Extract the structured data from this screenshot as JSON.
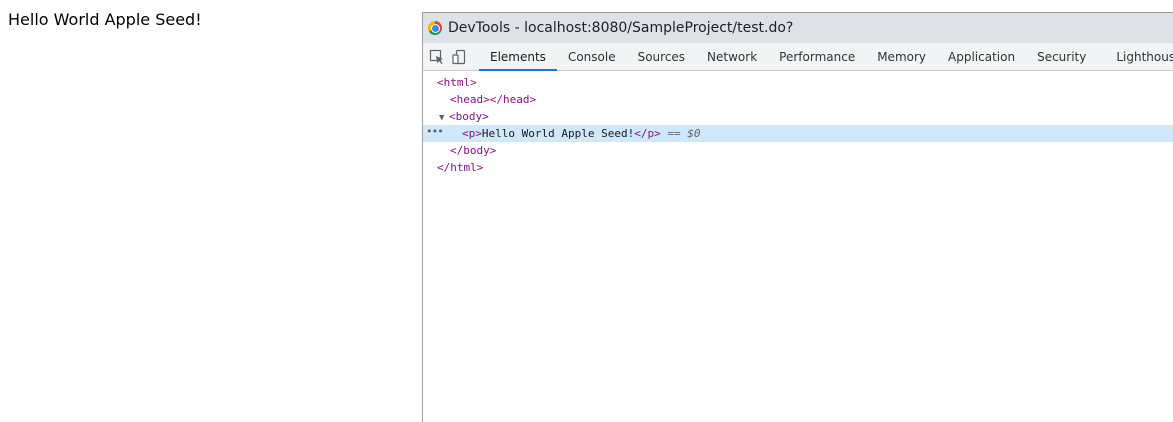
{
  "page": {
    "paragraph_text": "Hello World Apple Seed!"
  },
  "devtools": {
    "window_title": "DevTools - localhost:8080/SampleProject/test.do?",
    "tabs": [
      {
        "label": "Elements",
        "active": true
      },
      {
        "label": "Console",
        "active": false
      },
      {
        "label": "Sources",
        "active": false
      },
      {
        "label": "Network",
        "active": false
      },
      {
        "label": "Performance",
        "active": false
      },
      {
        "label": "Memory",
        "active": false
      },
      {
        "label": "Application",
        "active": false
      },
      {
        "label": "Security",
        "active": false
      },
      {
        "label": "Lighthouse",
        "active": false
      }
    ],
    "dom": {
      "html_open": "<html>",
      "head_line": "<head></head>",
      "body_open": "<body>",
      "p_open": "<p>",
      "p_text": "Hello World Apple Seed!",
      "p_close": "</p>",
      "selected_marker": "== $0",
      "body_close": "</body>",
      "html_close": "</html>",
      "expand_glyph": "▼",
      "ellipsis": "•••"
    },
    "colors": {
      "tag": "#881280",
      "selected_row": "#cfe8fc",
      "active_tab_underline": "#1a73e8"
    }
  }
}
